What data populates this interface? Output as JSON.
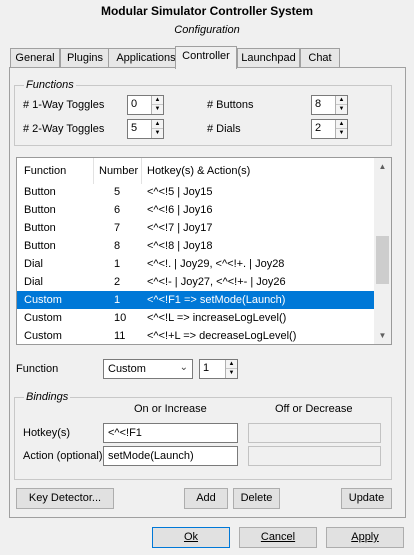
{
  "window": {
    "title": "Modular Simulator Controller System",
    "subtitle": "Configuration"
  },
  "tabs": [
    {
      "label": "General"
    },
    {
      "label": "Plugins"
    },
    {
      "label": "Applications"
    },
    {
      "label": "Controller"
    },
    {
      "label": "Launchpad"
    },
    {
      "label": "Chat"
    }
  ],
  "active_tab": "Controller",
  "functions_group": {
    "title": "Functions",
    "one_way_label": "# 1-Way Toggles",
    "one_way_value": "0",
    "two_way_label": "# 2-Way Toggles",
    "two_way_value": "5",
    "buttons_label": "# Buttons",
    "buttons_value": "8",
    "dials_label": "# Dials",
    "dials_value": "2"
  },
  "table": {
    "headers": [
      "Function",
      "Number",
      "Hotkey(s) & Action(s)"
    ],
    "rows": [
      {
        "function": "Button",
        "number": "5",
        "hotkeys": "<^<!5 | Joy15"
      },
      {
        "function": "Button",
        "number": "6",
        "hotkeys": "<^<!6 | Joy16"
      },
      {
        "function": "Button",
        "number": "7",
        "hotkeys": "<^<!7 | Joy17"
      },
      {
        "function": "Button",
        "number": "8",
        "hotkeys": "<^<!8 | Joy18"
      },
      {
        "function": "Dial",
        "number": "1",
        "hotkeys": "<^<!. | Joy29, <^<!+. | Joy28"
      },
      {
        "function": "Dial",
        "number": "2",
        "hotkeys": "<^<!- | Joy27, <^<!+- | Joy26"
      },
      {
        "function": "Custom",
        "number": "1",
        "hotkeys": "<^<!F1 => setMode(Launch)"
      },
      {
        "function": "Custom",
        "number": "10",
        "hotkeys": "<^<!L => increaseLogLevel()"
      },
      {
        "function": "Custom",
        "number": "11",
        "hotkeys": "<^<!+L => decreaseLogLevel()"
      }
    ],
    "selected_row": 6
  },
  "function_editor": {
    "label": "Function",
    "type_value": "Custom",
    "number_value": "1"
  },
  "bindings": {
    "title": "Bindings",
    "col_on": "On or Increase",
    "col_off": "Off or Decrease",
    "hotkeys_label": "Hotkey(s)",
    "action_label": "Action (optional)",
    "hotkey_on": "<^<!F1",
    "action_on": "setMode(Launch)",
    "hotkey_off": "",
    "action_off": ""
  },
  "buttons": {
    "key_detector": "Key Detector...",
    "add": "Add",
    "delete": "Delete",
    "update": "Update",
    "ok": "Ok",
    "cancel": "Cancel",
    "apply": "Apply"
  },
  "colors": {
    "selection": "#0078d7",
    "window_bg": "#f0f0f0"
  }
}
